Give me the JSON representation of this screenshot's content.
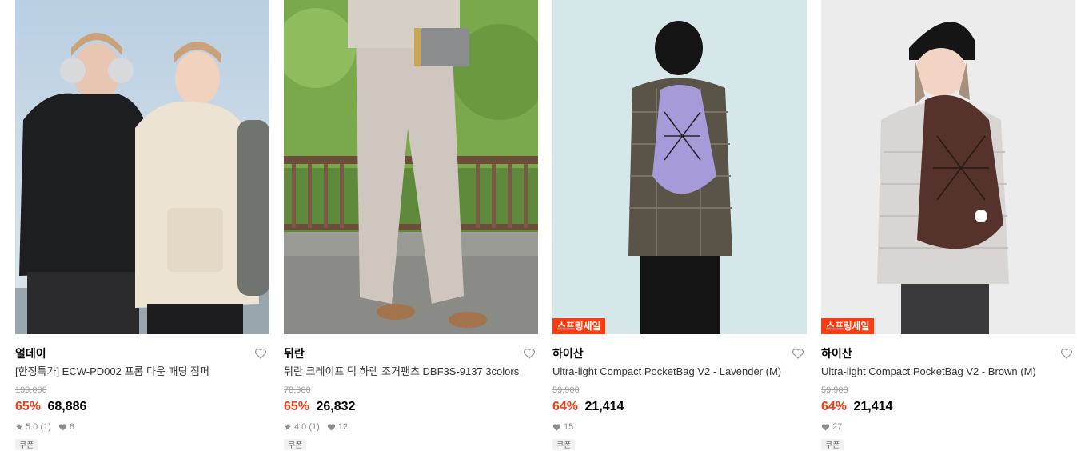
{
  "products": [
    {
      "brand": "얼데이",
      "name": "[한정특가] ECW-PD002 프롬 다운 패딩 점퍼",
      "original_price": "199,000",
      "discount": "65%",
      "price": "68,886",
      "rating": "5.0",
      "review_count": "(1)",
      "likes": "8",
      "badge": "",
      "coupon": "쿠폰"
    },
    {
      "brand": "뒤란",
      "name": "뒤란 크레이프 턱 하렘 조거팬츠 DBF3S-9137 3colors",
      "original_price": "78,000",
      "discount": "65%",
      "price": "26,832",
      "rating": "4.0",
      "review_count": "(1)",
      "likes": "12",
      "badge": "",
      "coupon": "쿠폰"
    },
    {
      "brand": "하이산",
      "name": "Ultra-light Compact PocketBag V2 - Lavender (M)",
      "original_price": "59,900",
      "discount": "64%",
      "price": "21,414",
      "rating": "",
      "review_count": "",
      "likes": "15",
      "badge": "스프링세일",
      "coupon": "쿠폰"
    },
    {
      "brand": "하이산",
      "name": "Ultra-light Compact PocketBag V2 - Brown (M)",
      "original_price": "59,900",
      "discount": "64%",
      "price": "21,414",
      "rating": "",
      "review_count": "",
      "likes": "27",
      "badge": "스프링세일",
      "coupon": "쿠폰"
    }
  ],
  "colors": {
    "discount": "#ff3b0f",
    "badge_bg": "#ff3b0f",
    "muted": "#8c8c8c"
  },
  "icons": {
    "heart": "heart-outline-icon",
    "star": "star-icon",
    "like": "heart-filled-icon"
  }
}
